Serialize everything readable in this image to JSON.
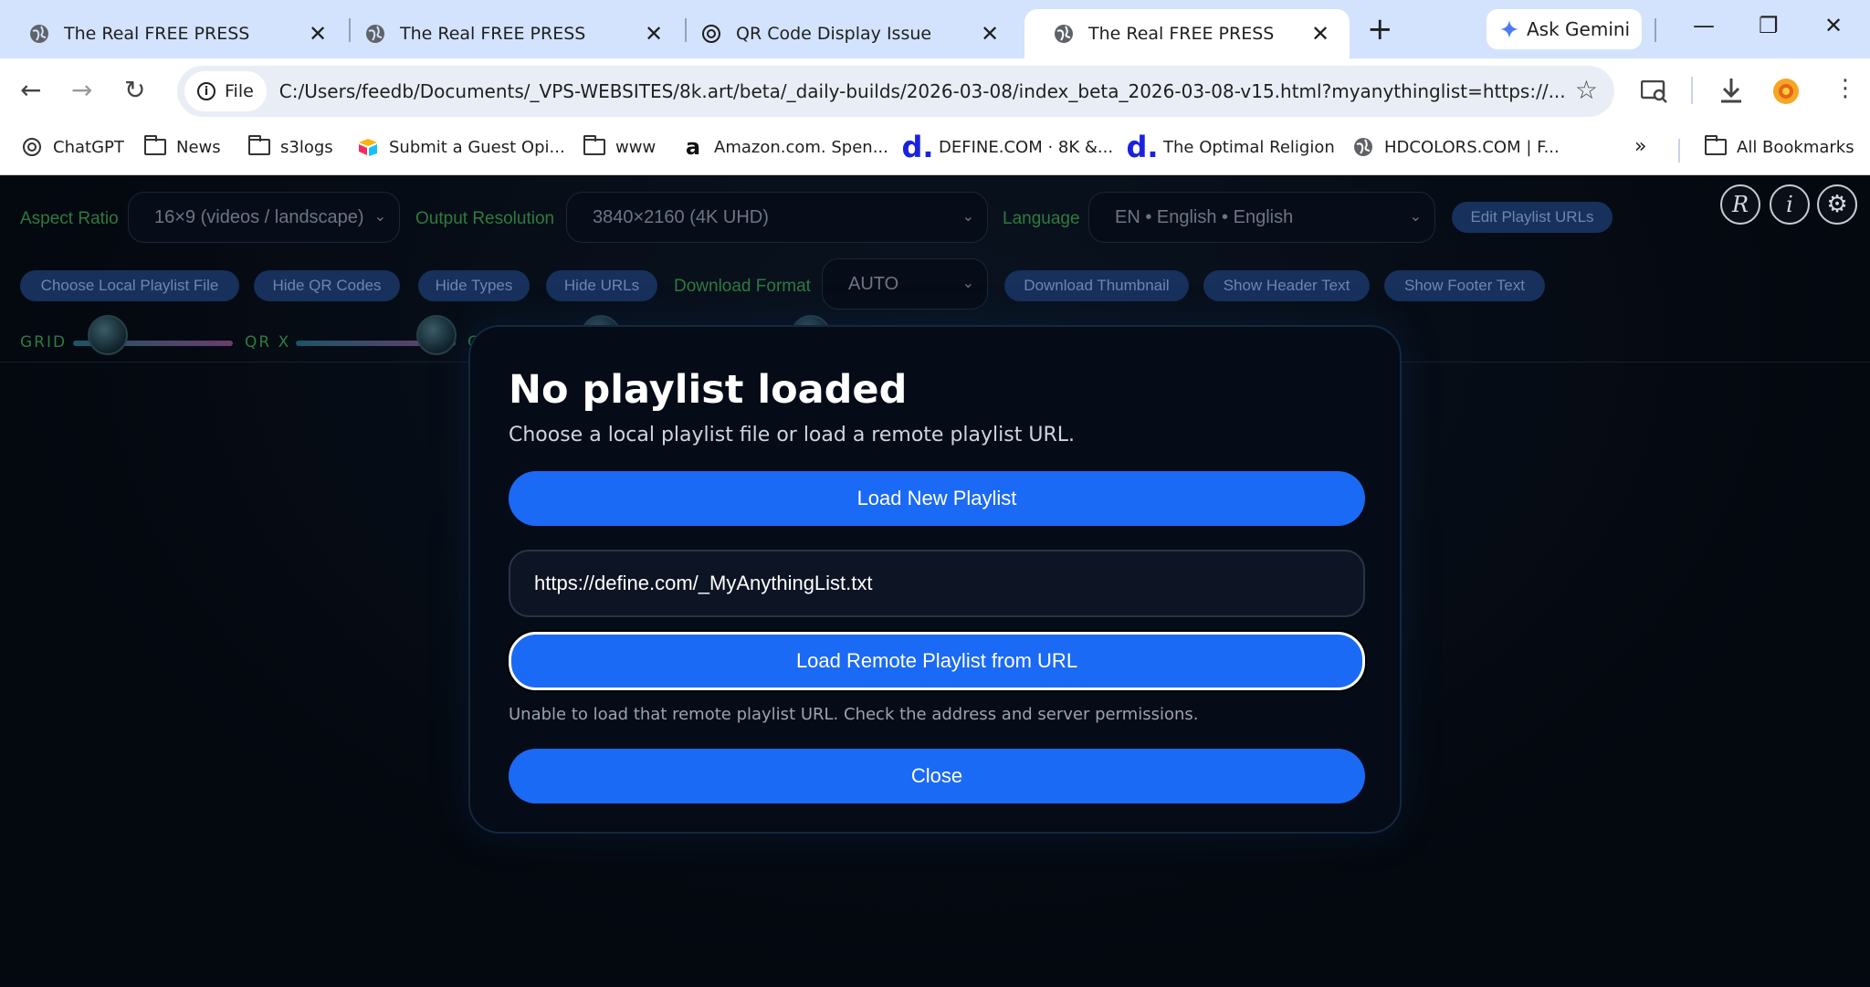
{
  "browser": {
    "tabs": [
      {
        "title": "The Real FREE PRESS",
        "active": false,
        "icon": "globe-icon"
      },
      {
        "title": "The Real FREE PRESS",
        "active": false,
        "icon": "globe-icon"
      },
      {
        "title": "QR Code Display Issue",
        "active": false,
        "icon": "openai-icon"
      },
      {
        "title": "The Real FREE PRESS",
        "active": true,
        "icon": "globe-icon"
      }
    ],
    "ask_gemini": "Ask Gemini",
    "file_chip": "File",
    "url": "C:/Users/feedb/Documents/_VPS-WEBSITES/8k.art/beta/_daily-builds/2026-03-08/index_beta_2026-03-08-v15.html?myanythinglist=https://...",
    "bookmarks": [
      {
        "label": "ChatGPT",
        "icon": "openai-icon"
      },
      {
        "label": "News",
        "icon": "folder-icon"
      },
      {
        "label": "s3logs",
        "icon": "folder-icon"
      },
      {
        "label": "Submit a Guest Opi...",
        "icon": "airtable-icon"
      },
      {
        "label": "www",
        "icon": "folder-icon"
      },
      {
        "label": "Amazon.com. Spen...",
        "icon": "amazon-icon"
      },
      {
        "label": "DEFINE.COM · 8K &...",
        "icon": "define-d-icon"
      },
      {
        "label": "The Optimal Religion",
        "icon": "define-d-icon"
      },
      {
        "label": "HDCOLORS.COM | F...",
        "icon": "globe-icon"
      }
    ],
    "all_bookmarks": "All Bookmarks"
  },
  "controls": {
    "aspect_ratio_label": "Aspect Ratio",
    "aspect_ratio_value": "16×9 (videos / landscape)",
    "output_resolution_label": "Output Resolution",
    "output_resolution_value": "3840×2160 (4K UHD)",
    "language_label": "Language",
    "language_value": "EN • English • English",
    "edit_playlist": "Edit Playlist URLs",
    "choose_local": "Choose Local Playlist File",
    "hide_qr": "Hide QR Codes",
    "hide_types": "Hide Types",
    "hide_urls": "Hide URLs",
    "download_format_label": "Download Format",
    "download_format_value": "AUTO",
    "download_thumbnail": "Download Thumbnail",
    "show_header": "Show Header Text",
    "show_footer": "Show Footer Text",
    "icon_r": "R",
    "icon_i": "i",
    "slider_grid_label": "GRID",
    "slider_qrx_label": "QR X",
    "slider_qrx_partial": "C"
  },
  "modal": {
    "title": "No playlist loaded",
    "subtitle": "Choose a local playlist file or load a remote playlist URL.",
    "load_new": "Load New Playlist",
    "url_value": "https://define.com/_MyAnythingList.txt",
    "load_remote": "Load Remote Playlist from URL",
    "error": "Unable to load that remote playlist URL. Check the address and server permissions.",
    "close": "Close"
  },
  "colors": {
    "accent_blue": "#1b6af5",
    "label_green": "#2f7a3f",
    "tabstrip": "#d3e3fd"
  }
}
